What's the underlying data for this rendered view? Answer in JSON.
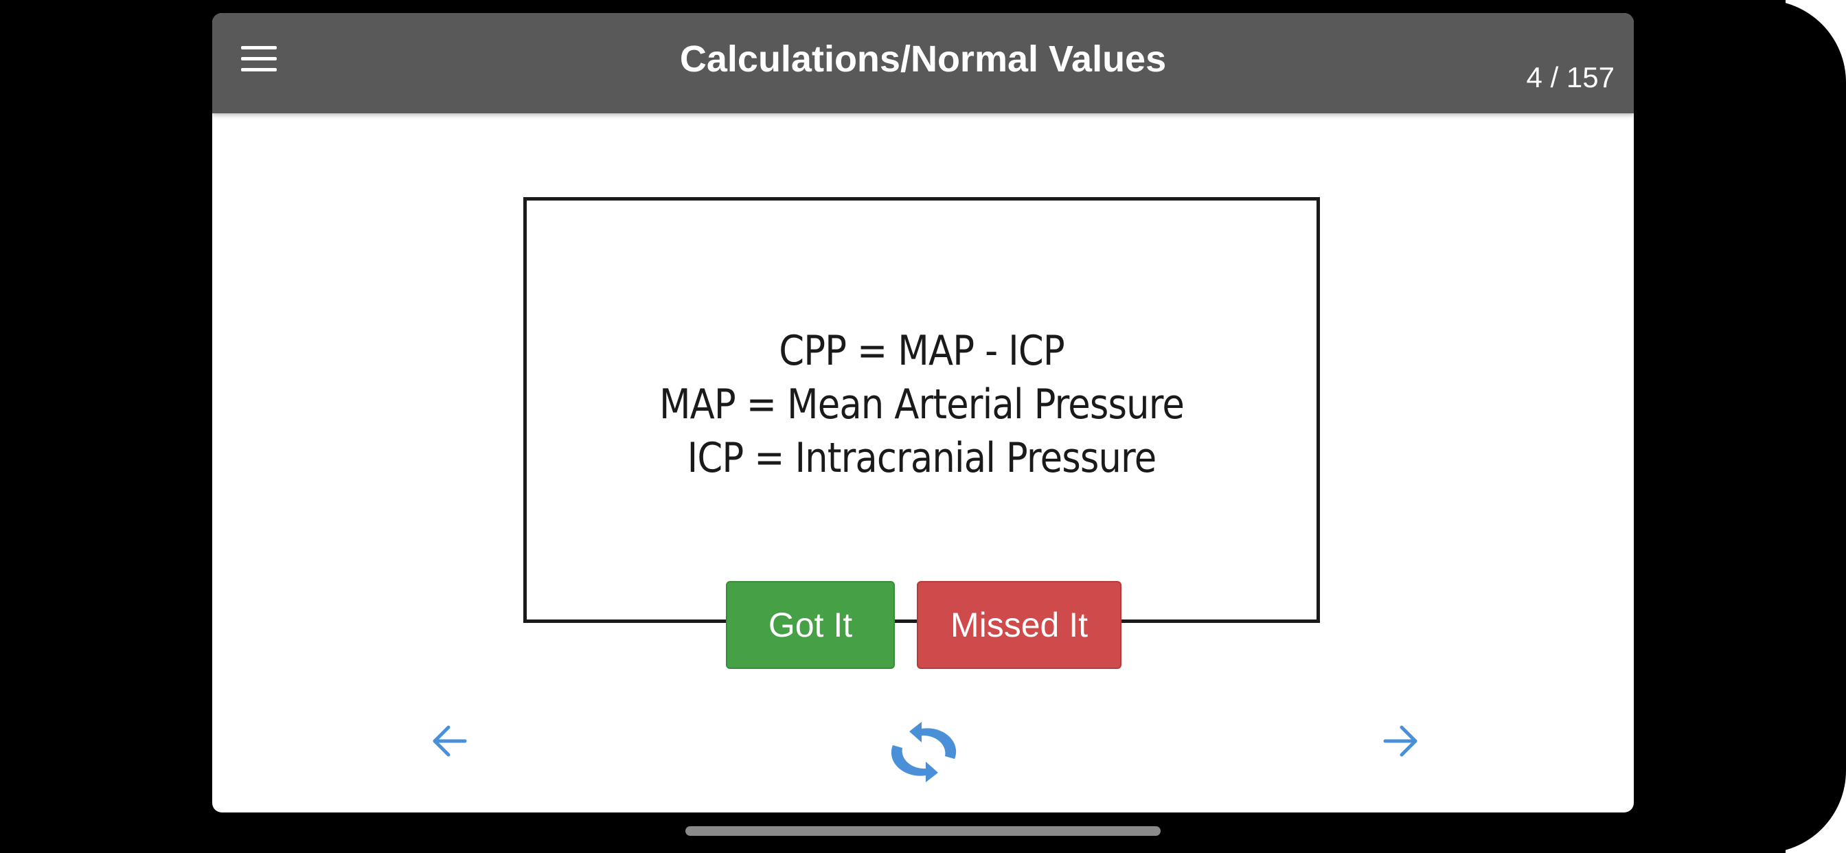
{
  "header": {
    "title": "Calculations/Normal Values",
    "counter": "4 / 157"
  },
  "card": {
    "lines": [
      "CPP = MAP - ICP",
      "MAP = Mean Arterial Pressure",
      "ICP = Intracranial Pressure"
    ]
  },
  "actions": {
    "got_it_label": "Got It",
    "missed_it_label": "Missed It"
  },
  "icons": {
    "menu": "hamburger-menu-icon",
    "previous": "arrow-left-icon",
    "next": "arrow-right-icon",
    "flip": "refresh-icon"
  },
  "colors": {
    "navbar": "#595959",
    "got_it": "#45a046",
    "missed_it": "#cf4a4a",
    "accent": "#4a90d9"
  }
}
